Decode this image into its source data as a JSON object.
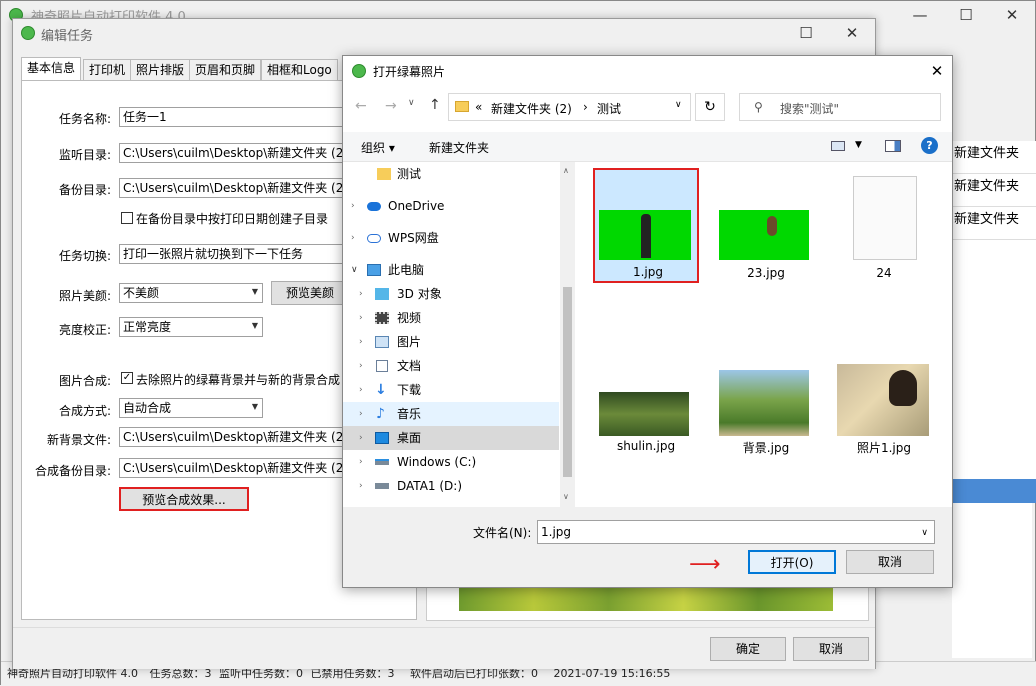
{
  "main": {
    "title": "神奇照片自动打印软件 4.0",
    "bg_list": [
      "新建文件夹",
      "新建文件夹",
      "新建文件夹"
    ],
    "status": {
      "app": "神奇照片自动打印软件 4.0",
      "total": "任务总数：3",
      "monitoring": "监听中任务数：0",
      "disabled": "已禁用任务数：3",
      "printed": "软件启动后已打印张数：0",
      "time": "2021-07-19 15:16:55"
    }
  },
  "edit": {
    "title": "编辑任务",
    "tabs": [
      "基本信息",
      "打印机",
      "照片排版",
      "页眉和页脚",
      "相框和Logo"
    ],
    "fields": {
      "task_name_label": "任务名称:",
      "task_name": "任务一1",
      "monitor_label": "监听目录:",
      "monitor": "C:\\Users\\cuilm\\Desktop\\新建文件夹 (2)\\",
      "backup_label": "备份目录:",
      "backup": "C:\\Users\\cuilm\\Desktop\\新建文件夹 (2)\\",
      "date_subdir_label": "在备份目录中按打印日期创建子目录",
      "switch_label": "任务切换:",
      "switch": "打印一张照片就切换到下一下任务",
      "beauty_label": "照片美颜:",
      "beauty": "不美颜",
      "beauty_preview": "预览美颜",
      "brightness_label": "亮度校正:",
      "brightness": "正常亮度",
      "compose_label": "图片合成:",
      "compose_check": "去除照片的绿幕背景并与新的背景合成",
      "compose_mode_label": "合成方式:",
      "compose_mode": "自动合成",
      "new_bg_label": "新背景文件:",
      "new_bg": "C:\\Users\\cuilm\\Desktop\\新建文件夹 (2)\\",
      "compose_backup_label": "合成备份目录:",
      "compose_backup": "C:\\Users\\cuilm\\Desktop\\新建文件夹 (2)\\",
      "preview_compose": "预览合成效果..."
    },
    "ok": "确定",
    "cancel": "取消"
  },
  "dialog": {
    "title": "打开绿幕照片",
    "address": [
      "«",
      "新建文件夹 (2)",
      "›",
      "测试"
    ],
    "search_placeholder": "搜索\"测试\"",
    "organize": "组织 ▾",
    "new_folder": "新建文件夹",
    "nav": [
      "测试",
      "OneDrive",
      "WPS网盘",
      "此电脑",
      "3D 对象",
      "视频",
      "图片",
      "文档",
      "下载",
      "音乐",
      "桌面",
      "Windows (C:)",
      "DATA1 (D:)"
    ],
    "files": [
      {
        "name": "1.jpg"
      },
      {
        "name": "23.jpg"
      },
      {
        "name": "24"
      },
      {
        "name": "shulin.jpg"
      },
      {
        "name": "背景.jpg"
      },
      {
        "name": "照片1.jpg"
      }
    ],
    "filename_label": "文件名(N):",
    "filename": "1.jpg",
    "open": "打开(O)",
    "cancel": "取消"
  },
  "colors": {
    "accent": "#0078d7",
    "highlight": "#cce8ff",
    "red_box": "#e02020",
    "green_screen": "#00d800"
  }
}
